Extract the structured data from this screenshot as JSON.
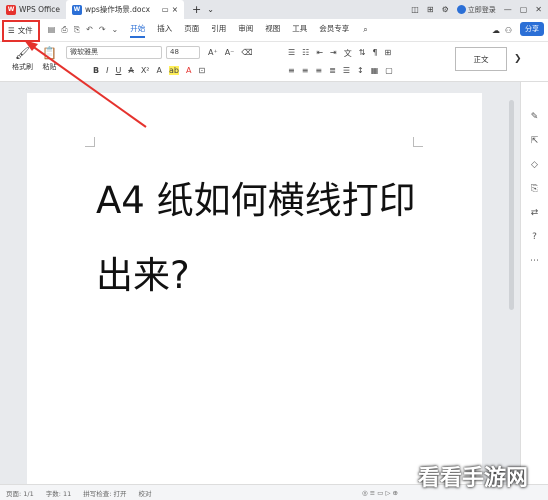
{
  "titlebar": {
    "app_tab": "WPS Office",
    "doc_tab": "wps操作场景.docx",
    "login": "立即登录",
    "close_tab": "×",
    "new_tab": "+"
  },
  "menubar": {
    "file": "文件",
    "tabs": [
      "开始",
      "插入",
      "页面",
      "引用",
      "审阅",
      "视图",
      "工具",
      "会员专享"
    ],
    "share": "分享"
  },
  "ribbon": {
    "format_painter": "格式刷",
    "paste": "粘贴",
    "font_name": "微软雅黑",
    "font_size": "48",
    "style_normal": "正文"
  },
  "document": {
    "line1": "A4 纸如何横线打印",
    "line2": "出来?"
  },
  "statusbar": {
    "page": "页面: 1/1",
    "words": "字数: 11",
    "spell": "拼写检查: 打开",
    "proof": "校对"
  },
  "watermark": "看看手游网"
}
